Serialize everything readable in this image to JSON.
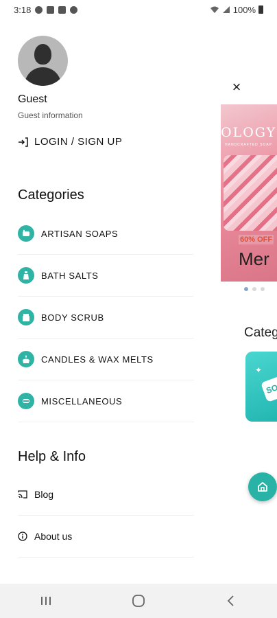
{
  "status_bar": {
    "time": "3:18",
    "battery": "100%"
  },
  "drawer": {
    "user": {
      "name": "Guest",
      "subtitle": "Guest information"
    },
    "login_label": "LOGIN / SIGN UP",
    "categories_title": "Categories",
    "categories": [
      {
        "label": "ARTISAN SOAPS",
        "icon": "soap-icon"
      },
      {
        "label": "BATH SALTS",
        "icon": "bottle-icon"
      },
      {
        "label": "BODY SCRUB",
        "icon": "jar-icon"
      },
      {
        "label": "CANDLES & WAX MELTS",
        "icon": "candle-icon"
      },
      {
        "label": "MISCELLANEOUS",
        "icon": "misc-icon"
      }
    ],
    "help_title": "Help & Info",
    "help_items": [
      {
        "label": "Blog",
        "icon": "cast-icon"
      },
      {
        "label": "About us",
        "icon": "info-icon"
      }
    ]
  },
  "background_page": {
    "close_symbol": "×",
    "banner": {
      "brand": "OLOGY",
      "sub": "HANDCRAFTED SOAP",
      "discount": "60% OFF",
      "title": "Mer"
    },
    "carousel": {
      "count": 3,
      "active": 0
    },
    "categories_title": "Categ",
    "category_tag": "SO"
  },
  "colors": {
    "accent": "#2fb3a5",
    "fab": "#28b3a6",
    "banner_pink": "#ec8e9e"
  }
}
